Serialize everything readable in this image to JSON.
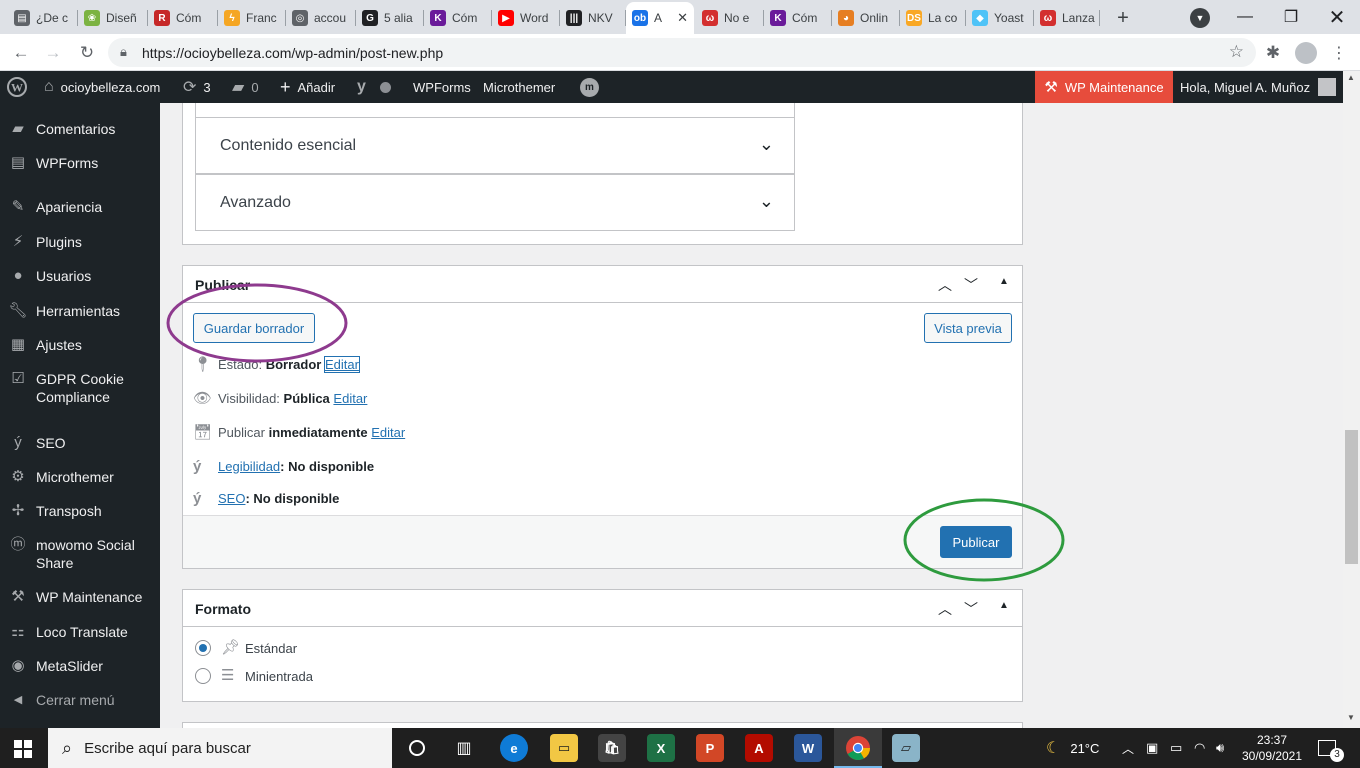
{
  "browser": {
    "tabs": [
      {
        "label": "¿De c",
        "icon": "doc-icon",
        "color": "#5f6368"
      },
      {
        "label": "Diseñ",
        "icon": "green-leaf-icon",
        "color": "#7cb342"
      },
      {
        "label": "Cóm",
        "icon": "r-logo-icon",
        "color": "#c62828"
      },
      {
        "label": "Franc",
        "icon": "lightning-icon",
        "color": "#f5a623"
      },
      {
        "label": "accou",
        "icon": "globe-icon",
        "color": "#5f6368"
      },
      {
        "label": "5 alia",
        "icon": "g-logo-icon",
        "color": "#202124"
      },
      {
        "label": "Cóm",
        "icon": "k-logo-icon",
        "color": "#6a1b9a"
      },
      {
        "label": "Word",
        "icon": "youtube-icon",
        "color": "#ff0000"
      },
      {
        "label": "NKV",
        "icon": "library-icon",
        "color": "#202124"
      },
      {
        "label": "A",
        "icon": "ob-logo-icon",
        "color": "#1a73e8",
        "active": true
      },
      {
        "label": "No e",
        "icon": "w-red-logo-icon",
        "color": "#d32f2f"
      },
      {
        "label": "Cóm",
        "icon": "k-logo-icon",
        "color": "#6a1b9a"
      },
      {
        "label": "Onlin",
        "icon": "cat-icon",
        "color": "#e67e22"
      },
      {
        "label": "La co",
        "icon": "ds-logo-icon",
        "color": "#f9a825"
      },
      {
        "label": "Yoast",
        "icon": "cube-icon",
        "color": "#4fc3f7"
      },
      {
        "label": "Lanza",
        "icon": "w-red-logo-icon",
        "color": "#d32f2f"
      }
    ],
    "url": "https://ocioybelleza.com/wp-admin/post-new.php"
  },
  "adminbar": {
    "site": "ocioybelleza.com",
    "updates": "3",
    "comments": "0",
    "add_new": "Añadir",
    "wpforms": "WPForms",
    "microthemer": "Microthemer",
    "maintenance": "WP Maintenance",
    "greeting": "Hola, Miguel A. Muñoz"
  },
  "sidebar": {
    "items": [
      {
        "label": "Comentarios",
        "icon": "comment-icon"
      },
      {
        "label": "WPForms",
        "icon": "form-icon"
      },
      {
        "label": "Apariencia",
        "icon": "brush-icon"
      },
      {
        "label": "Plugins",
        "icon": "plug-icon"
      },
      {
        "label": "Usuarios",
        "icon": "user-icon"
      },
      {
        "label": "Herramientas",
        "icon": "wrench-icon"
      },
      {
        "label": "Ajustes",
        "icon": "settings-icon"
      },
      {
        "label": "GDPR Cookie Compliance",
        "icon": "check-icon"
      },
      {
        "label": "SEO",
        "icon": "yoast-icon"
      },
      {
        "label": "Microthemer",
        "icon": "gear-icon"
      },
      {
        "label": "Transposh",
        "icon": "transposh-icon"
      },
      {
        "label": "mowomo Social Share",
        "icon": "mowomo-icon"
      },
      {
        "label": "WP Maintenance",
        "icon": "tools-icon"
      },
      {
        "label": "Loco Translate",
        "icon": "translate-icon"
      },
      {
        "label": "MetaSlider",
        "icon": "slider-icon"
      },
      {
        "label": "Cerrar menú",
        "icon": "collapse-icon"
      }
    ]
  },
  "content": {
    "accordions": [
      {
        "label": "Contenido esencial"
      },
      {
        "label": "Avanzado"
      }
    ],
    "publish": {
      "title": "Publicar",
      "save_draft": "Guardar borrador",
      "preview": "Vista previa",
      "status_label": "Estado:",
      "status_value": "Borrador",
      "visibility_label": "Visibilidad:",
      "visibility_value": "Pública",
      "publish_label": "Publicar",
      "publish_value": "inmediatamente",
      "edit": "Editar",
      "readability_link": "Legibilidad",
      "readability_value": ": No disponible",
      "seo_link": "SEO",
      "seo_value": ": No disponible",
      "publish_button": "Publicar"
    },
    "format": {
      "title": "Formato",
      "options": [
        {
          "label": "Estándar",
          "checked": true
        },
        {
          "label": "Minientrada",
          "checked": false
        }
      ]
    }
  },
  "annotations": {
    "purple": "#8e3a8e",
    "green": "#2e9b3e"
  },
  "taskbar": {
    "search_placeholder": "Escribe aquí para buscar",
    "weather": "21°C",
    "time": "23:37",
    "date": "30/09/2021",
    "notifications": "3"
  }
}
